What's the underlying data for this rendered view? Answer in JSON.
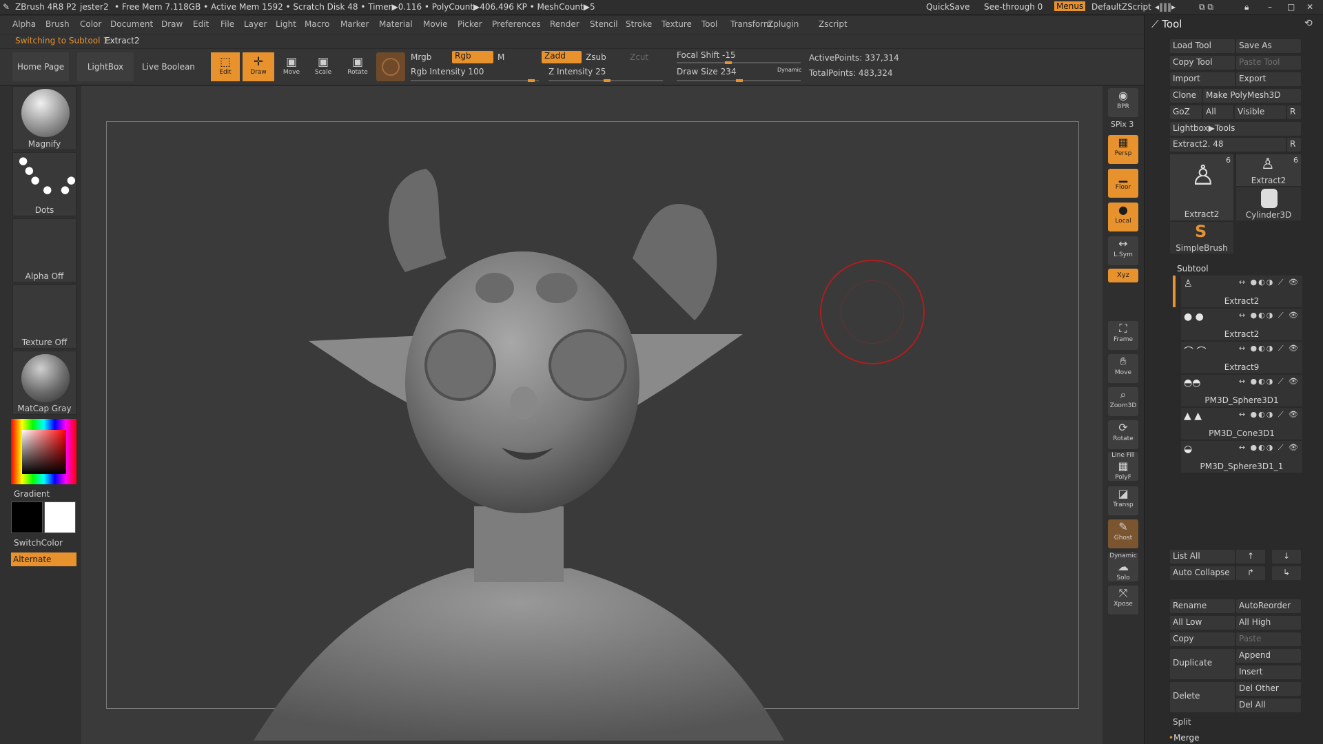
{
  "app": {
    "name": "ZBrush 4R8 P2",
    "doc": "jester2",
    "stats": "• Free Mem 7.118GB • Active Mem 1592 • Scratch Disk 48 • Timer▶0.116 • PolyCount▶406.496 KP • MeshCount▶5",
    "quicksave": "QuickSave",
    "seethrough": "See-through  0",
    "menus": "Menus",
    "script": "DefaultZScript"
  },
  "menus": [
    "Alpha",
    "Brush",
    "Color",
    "Document",
    "Draw",
    "Edit",
    "File",
    "Layer",
    "Light",
    "Macro",
    "Marker",
    "Material",
    "Movie",
    "Picker",
    "Preferences",
    "Render",
    "Stencil",
    "Stroke",
    "Texture",
    "Tool",
    "Transform",
    "Zplugin",
    "Zscript"
  ],
  "notice": {
    "label": "Switching to Subtool 1:",
    "value": "Extract2"
  },
  "shelf": {
    "home": "Home Page",
    "lightbox": "LightBox",
    "liveboolean": "Live Boolean",
    "edit": "Edit",
    "draw": "Draw",
    "move": "Move",
    "scale": "Scale",
    "rotate": "Rotate",
    "mrgb": "Mrgb",
    "rgb": "Rgb",
    "m": "M",
    "zadd": "Zadd",
    "zsub": "Zsub",
    "zcut": "Zcut",
    "rgb_intensity": "Rgb Intensity 100",
    "z_intensity": "Z Intensity 25",
    "focal_shift": "Focal Shift -15",
    "draw_size": "Draw Size 234",
    "dynamic": "Dynamic",
    "active_points": "ActivePoints: 337,314",
    "total_points": "TotalPoints: 483,324"
  },
  "left": {
    "brush": "Magnify",
    "stroke": "Dots",
    "alpha": "Alpha Off",
    "texture": "Texture Off",
    "material": "MatCap Gray",
    "gradient": "Gradient",
    "switchcolor": "SwitchColor",
    "alternate": "Alternate"
  },
  "dock": {
    "bpr": "BPR",
    "spix": "SPix 3",
    "persp": "Persp",
    "floor": "Floor",
    "local": "Local",
    "lsym": "L.Sym",
    "xyz": "Xyz",
    "frame": "Frame",
    "move": "Move",
    "zoom3d": "Zoom3D",
    "rotate": "Rotate",
    "linefill": "Line Fill",
    "polyf": "PolyF",
    "transp": "Transp",
    "ghost": "Ghost",
    "dynamic": "Dynamic",
    "solo": "Solo",
    "xpose": "Xpose"
  },
  "tool": {
    "title": "Tool",
    "load": "Load Tool",
    "saveas": "Save As",
    "copy": "Copy Tool",
    "paste": "Paste Tool",
    "import": "Import",
    "export": "Export",
    "clone": "Clone",
    "polymesh": "Make PolyMesh3D",
    "goz": "GoZ",
    "all": "All",
    "visible": "Visible",
    "r": "R",
    "lightbox": "Lightbox▶Tools",
    "current": "Extract2. 48",
    "thumbs": [
      {
        "name": "Extract2",
        "count": "6"
      },
      {
        "name": "Extract2",
        "count": "6"
      },
      {
        "name": "Cylinder3D"
      },
      {
        "name": "SimpleBrush"
      }
    ]
  },
  "subtool": {
    "title": "Subtool",
    "items": [
      {
        "name": "Extract2"
      },
      {
        "name": "Extract2"
      },
      {
        "name": "Extract9"
      },
      {
        "name": "PM3D_Sphere3D1"
      },
      {
        "name": "PM3D_Cone3D1"
      },
      {
        "name": "PM3D_Sphere3D1_1"
      }
    ],
    "listall": "List All",
    "autocollapse": "Auto Collapse",
    "rename": "Rename",
    "autoreorder": "AutoReorder",
    "alllow": "All Low",
    "allhigh": "All High",
    "copy": "Copy",
    "paste": "Paste",
    "duplicate": "Duplicate",
    "append": "Append",
    "insert": "Insert",
    "delete": "Delete",
    "delother": "Del Other",
    "delall": "Del All",
    "split": "Split",
    "merge": "Merge"
  },
  "colors": {
    "accent": "#e8922e",
    "panel": "#2a2a2a",
    "viewport": "#3a3a3a"
  }
}
